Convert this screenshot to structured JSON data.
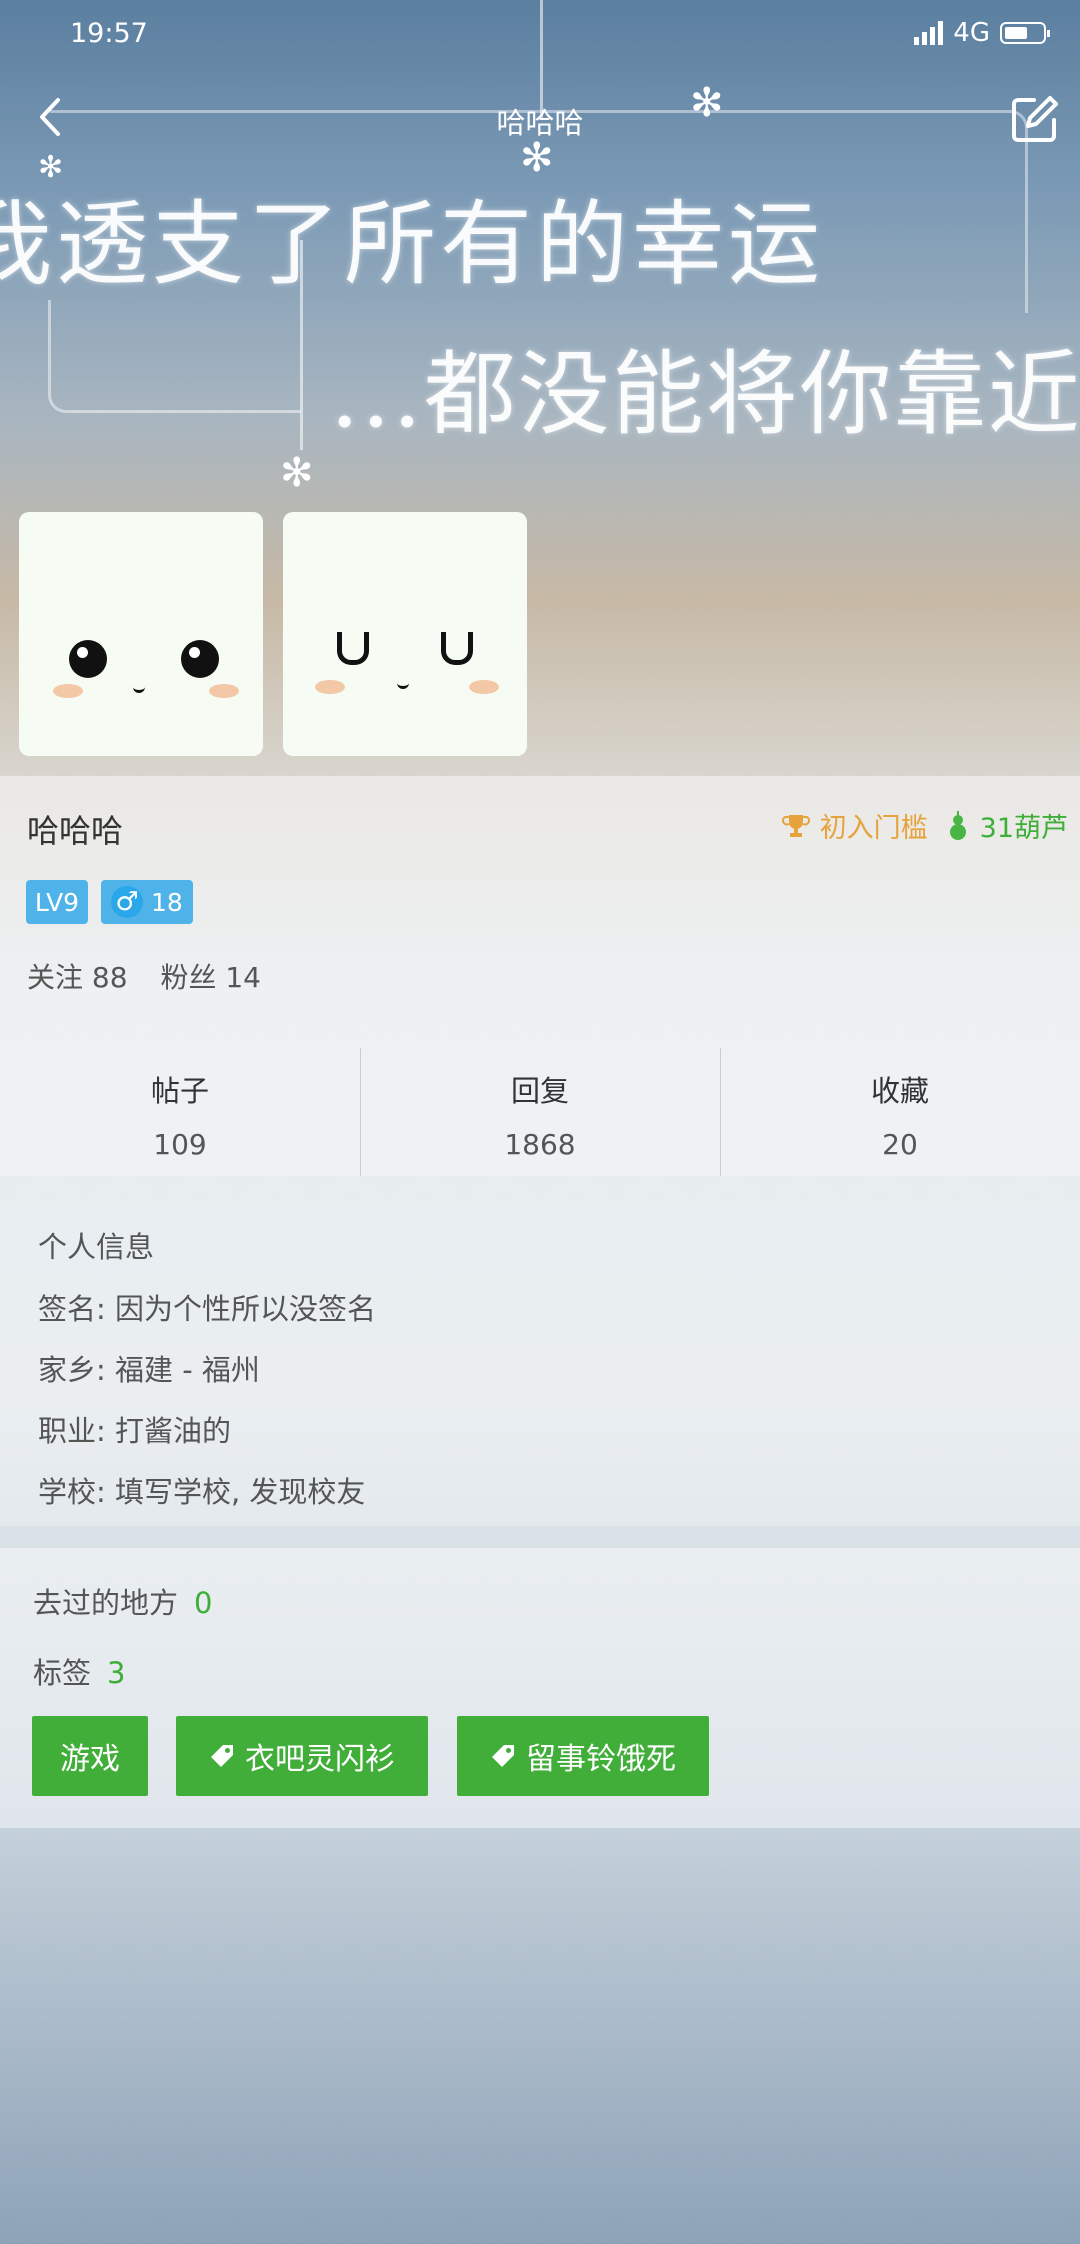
{
  "status_bar": {
    "time": "19:57",
    "network": "4G"
  },
  "header": {
    "title": "哈哈哈"
  },
  "cover": {
    "line1": "我透支了所有的幸运",
    "line2": "...都没能将你靠近"
  },
  "profile": {
    "username": "哈哈哈",
    "rank": "初入门槛",
    "gourds": "31葫芦",
    "level": "LV9",
    "gender_symbol": "♂",
    "age": "18",
    "follow_text": "关注 88",
    "fans_text": "粉丝 14"
  },
  "stats": [
    {
      "label": "帖子",
      "value": "109"
    },
    {
      "label": "回复",
      "value": "1868"
    },
    {
      "label": "收藏",
      "value": "20"
    }
  ],
  "info": {
    "heading": "个人信息",
    "signature": "签名: 因为个性所以没签名",
    "hometown": "家乡: 福建 - 福州",
    "job": "职业: 打酱油的",
    "school": "学校: 填写学校, 发现校友"
  },
  "places": {
    "label": "去过的地方",
    "count": "0"
  },
  "tags": {
    "label": "标签",
    "count": "3",
    "items": [
      "游戏",
      "衣吧灵闪衫",
      "留事铃饿死"
    ]
  },
  "colors": {
    "accent_green": "#41ae3a",
    "level_blue": "#4fb3ea",
    "rank_orange": "#e6a23c"
  }
}
